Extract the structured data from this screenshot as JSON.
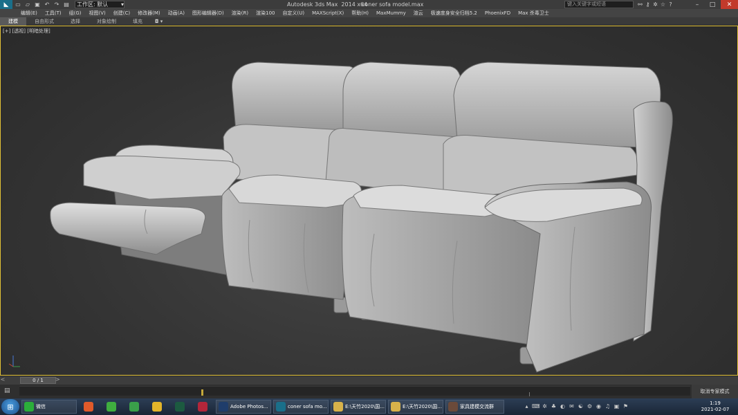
{
  "title_bar": {
    "app_title": "Autodesk 3ds Max  2014 x64",
    "file_name": "coner sofa model.max",
    "workspace_label": "工作区: 默认",
    "search_placeholder": "键入关键字或短语",
    "app_icon": "3ds-max-icon",
    "quick_access": [
      "new-icon",
      "open-icon",
      "save-icon",
      "undo-icon",
      "redo-icon",
      "project-icon"
    ],
    "right_icons": [
      "binoculars-icon",
      "key-icon",
      "community-icon",
      "star-icon",
      "help-icon"
    ]
  },
  "menu": [
    "编辑(E)",
    "工具(T)",
    "组(G)",
    "视图(V)",
    "创建(C)",
    "修改器(M)",
    "动画(A)",
    "图形编辑器(D)",
    "渲染(R)",
    "渲染100",
    "自定义(U)",
    "MAXScript(X)",
    "帮助(H)",
    "MaxMummy",
    "渲云",
    "极速度身安全归档5.2",
    "PhoenixFD",
    "Max 杀毒卫士"
  ],
  "ribbon_tabs": [
    "建模",
    "自由形式",
    "选择",
    "对象绘制",
    "填充"
  ],
  "ribbon_active": "建模",
  "ribbon_toggle": "◘ ▾",
  "viewport": {
    "label": "[+] [透视] [明暗处理]",
    "border_color": "#e3c236"
  },
  "timeslider": {
    "frame_label": "0 / 1"
  },
  "expert_mode_label": "取消专家模式",
  "taskbar": {
    "items": [
      {
        "label": "微信",
        "icon": "wechat-icon",
        "color": "#2bae3a"
      },
      {
        "label": "",
        "icon": "camtasia-icon",
        "color": "#e05a2a",
        "pinned": true
      },
      {
        "label": "",
        "icon": "camtasia-green-icon",
        "color": "#3fae3f",
        "pinned": true
      },
      {
        "label": "",
        "icon": "swirl-icon",
        "color": "#3aa04a",
        "pinned": true
      },
      {
        "label": "",
        "icon": "chrome-icon",
        "color": "#e3b52a",
        "pinned": true
      },
      {
        "label": "",
        "icon": "audition-icon",
        "color": "#1c5a40",
        "pinned": true
      },
      {
        "label": "",
        "icon": "calligraphy-icon",
        "color": "#b3263a",
        "pinned": true
      },
      {
        "label": "Adobe Photos...",
        "icon": "photoshop-icon",
        "color": "#1f3d6b"
      },
      {
        "label": "coner sofa mo...",
        "icon": "3ds-max-icon",
        "color": "#1a6f8a"
      },
      {
        "label": "E:\\天竹2020\\国...",
        "icon": "folder-icon",
        "color": "#d8b24a"
      },
      {
        "label": "E:\\天竹2020\\国...",
        "icon": "folder-icon",
        "color": "#d8b24a"
      },
      {
        "label": "家具建模交流群",
        "icon": "group-chat-icon",
        "color": "#6b4a3a"
      }
    ],
    "clock_time": "1:19",
    "clock_date": "2021-02-07"
  }
}
